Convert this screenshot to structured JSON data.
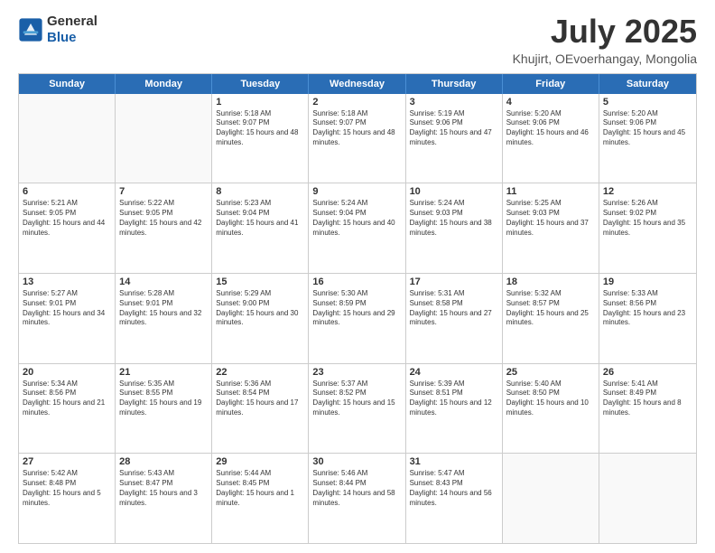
{
  "logo": {
    "general": "General",
    "blue": "Blue"
  },
  "header": {
    "month": "July 2025",
    "location": "Khujirt, OEvoerhangay, Mongolia"
  },
  "days": [
    "Sunday",
    "Monday",
    "Tuesday",
    "Wednesday",
    "Thursday",
    "Friday",
    "Saturday"
  ],
  "weeks": [
    [
      {
        "day": "",
        "content": ""
      },
      {
        "day": "",
        "content": ""
      },
      {
        "day": "1",
        "content": "Sunrise: 5:18 AM\nSunset: 9:07 PM\nDaylight: 15 hours and 48 minutes."
      },
      {
        "day": "2",
        "content": "Sunrise: 5:18 AM\nSunset: 9:07 PM\nDaylight: 15 hours and 48 minutes."
      },
      {
        "day": "3",
        "content": "Sunrise: 5:19 AM\nSunset: 9:06 PM\nDaylight: 15 hours and 47 minutes."
      },
      {
        "day": "4",
        "content": "Sunrise: 5:20 AM\nSunset: 9:06 PM\nDaylight: 15 hours and 46 minutes."
      },
      {
        "day": "5",
        "content": "Sunrise: 5:20 AM\nSunset: 9:06 PM\nDaylight: 15 hours and 45 minutes."
      }
    ],
    [
      {
        "day": "6",
        "content": "Sunrise: 5:21 AM\nSunset: 9:05 PM\nDaylight: 15 hours and 44 minutes."
      },
      {
        "day": "7",
        "content": "Sunrise: 5:22 AM\nSunset: 9:05 PM\nDaylight: 15 hours and 42 minutes."
      },
      {
        "day": "8",
        "content": "Sunrise: 5:23 AM\nSunset: 9:04 PM\nDaylight: 15 hours and 41 minutes."
      },
      {
        "day": "9",
        "content": "Sunrise: 5:24 AM\nSunset: 9:04 PM\nDaylight: 15 hours and 40 minutes."
      },
      {
        "day": "10",
        "content": "Sunrise: 5:24 AM\nSunset: 9:03 PM\nDaylight: 15 hours and 38 minutes."
      },
      {
        "day": "11",
        "content": "Sunrise: 5:25 AM\nSunset: 9:03 PM\nDaylight: 15 hours and 37 minutes."
      },
      {
        "day": "12",
        "content": "Sunrise: 5:26 AM\nSunset: 9:02 PM\nDaylight: 15 hours and 35 minutes."
      }
    ],
    [
      {
        "day": "13",
        "content": "Sunrise: 5:27 AM\nSunset: 9:01 PM\nDaylight: 15 hours and 34 minutes."
      },
      {
        "day": "14",
        "content": "Sunrise: 5:28 AM\nSunset: 9:01 PM\nDaylight: 15 hours and 32 minutes."
      },
      {
        "day": "15",
        "content": "Sunrise: 5:29 AM\nSunset: 9:00 PM\nDaylight: 15 hours and 30 minutes."
      },
      {
        "day": "16",
        "content": "Sunrise: 5:30 AM\nSunset: 8:59 PM\nDaylight: 15 hours and 29 minutes."
      },
      {
        "day": "17",
        "content": "Sunrise: 5:31 AM\nSunset: 8:58 PM\nDaylight: 15 hours and 27 minutes."
      },
      {
        "day": "18",
        "content": "Sunrise: 5:32 AM\nSunset: 8:57 PM\nDaylight: 15 hours and 25 minutes."
      },
      {
        "day": "19",
        "content": "Sunrise: 5:33 AM\nSunset: 8:56 PM\nDaylight: 15 hours and 23 minutes."
      }
    ],
    [
      {
        "day": "20",
        "content": "Sunrise: 5:34 AM\nSunset: 8:56 PM\nDaylight: 15 hours and 21 minutes."
      },
      {
        "day": "21",
        "content": "Sunrise: 5:35 AM\nSunset: 8:55 PM\nDaylight: 15 hours and 19 minutes."
      },
      {
        "day": "22",
        "content": "Sunrise: 5:36 AM\nSunset: 8:54 PM\nDaylight: 15 hours and 17 minutes."
      },
      {
        "day": "23",
        "content": "Sunrise: 5:37 AM\nSunset: 8:52 PM\nDaylight: 15 hours and 15 minutes."
      },
      {
        "day": "24",
        "content": "Sunrise: 5:39 AM\nSunset: 8:51 PM\nDaylight: 15 hours and 12 minutes."
      },
      {
        "day": "25",
        "content": "Sunrise: 5:40 AM\nSunset: 8:50 PM\nDaylight: 15 hours and 10 minutes."
      },
      {
        "day": "26",
        "content": "Sunrise: 5:41 AM\nSunset: 8:49 PM\nDaylight: 15 hours and 8 minutes."
      }
    ],
    [
      {
        "day": "27",
        "content": "Sunrise: 5:42 AM\nSunset: 8:48 PM\nDaylight: 15 hours and 5 minutes."
      },
      {
        "day": "28",
        "content": "Sunrise: 5:43 AM\nSunset: 8:47 PM\nDaylight: 15 hours and 3 minutes."
      },
      {
        "day": "29",
        "content": "Sunrise: 5:44 AM\nSunset: 8:45 PM\nDaylight: 15 hours and 1 minute."
      },
      {
        "day": "30",
        "content": "Sunrise: 5:46 AM\nSunset: 8:44 PM\nDaylight: 14 hours and 58 minutes."
      },
      {
        "day": "31",
        "content": "Sunrise: 5:47 AM\nSunset: 8:43 PM\nDaylight: 14 hours and 56 minutes."
      },
      {
        "day": "",
        "content": ""
      },
      {
        "day": "",
        "content": ""
      }
    ]
  ]
}
